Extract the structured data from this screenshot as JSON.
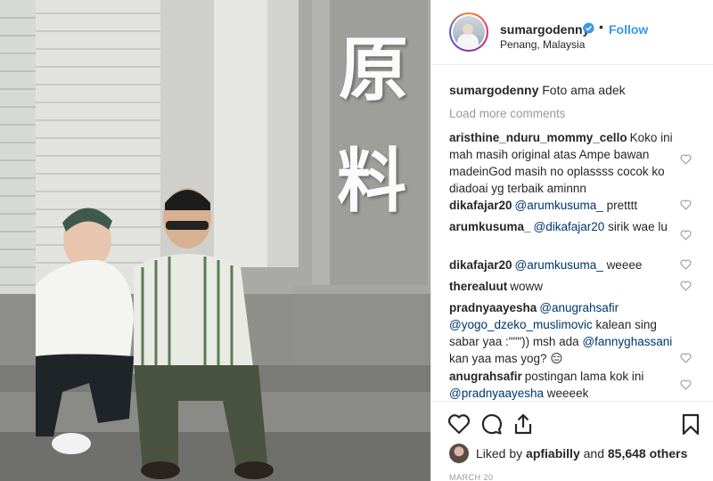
{
  "photo": {
    "sign_chars": [
      "原",
      "料"
    ]
  },
  "post": {
    "username": "sumargodenny",
    "follow_label": "Follow",
    "separator": "•",
    "location": "Penang, Malaysia",
    "caption_user": "sumargodenny",
    "caption_text": "Foto ama adek",
    "load_more_label": "Load more comments"
  },
  "comments": [
    {
      "user": "aristhine_nduru_mommy_cello",
      "text": "Koko ini mah masih original atas Ampe bawan madeinGod masih no oplassss cocok ko diadoai yg terbaik aminnn"
    },
    {
      "user": "dikafajar20",
      "mention": "@arumkusuma_",
      "text": "pretttt"
    },
    {
      "user": "arumkusuma_",
      "mention": "@dikafajar20",
      "text": "sirik wae lu"
    },
    {
      "user": "dikafajar20",
      "mention": "@arumkusuma_",
      "text": "weeee"
    },
    {
      "user": "therealuut",
      "text": "woww"
    },
    {
      "user": "pradnyaayesha",
      "mention": "@anugrahsafir",
      "mention2": "@yogo_dzeko_muslimovic",
      "text": "kalean sing sabar yaa :\"\"\")) msh ada",
      "mention3": "@fannyghassani",
      "text2": "kan yaa mas yog? 😑"
    },
    {
      "user": "anugrahsafir",
      "text": "postingan lama kok ini",
      "mention": "@pradnyaayesha",
      "text2": "weeeek"
    }
  ],
  "footer": {
    "liked_by_prefix": "Liked by",
    "liked_by_user": "apfiabilly",
    "liked_by_and": "and",
    "liked_by_count": "85,648 others",
    "date": "MARCH 20"
  },
  "colors": {
    "link": "#3897f0",
    "mention": "#003569",
    "muted": "#999999",
    "verified": "#3897f0"
  },
  "icons": [
    "verified-badge-icon",
    "heart-icon",
    "like-icon",
    "comment-icon",
    "share-icon",
    "bookmark-icon"
  ]
}
